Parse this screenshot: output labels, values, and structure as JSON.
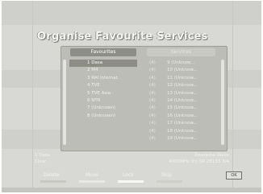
{
  "title": "Organise Favourite Services",
  "favourites": {
    "header": "Favourites",
    "items": [
      {
        "label": "1 Dasa",
        "selected": true
      },
      {
        "label": "2 M4",
        "selected": false
      },
      {
        "label": "3 RAI Internat.",
        "selected": false
      },
      {
        "label": "4 TVE",
        "selected": false
      },
      {
        "label": "5 TVE Asia",
        "selected": false
      },
      {
        "label": "6 NTR",
        "selected": false
      },
      {
        "label": "7 (Unknown)",
        "selected": false
      },
      {
        "label": "8 (Unknown)",
        "selected": false
      }
    ]
  },
  "services": {
    "header": "Services",
    "items": [
      {
        "group": "(4)",
        "name": "9 (Unknow..."
      },
      {
        "group": "(4)",
        "name": "10 (Unknow..."
      },
      {
        "group": "(4)",
        "name": "11 (Unknow..."
      },
      {
        "group": "(4)",
        "name": "12 (Unknow..."
      },
      {
        "group": "(4)",
        "name": "13 (Unknow..."
      },
      {
        "group": "(4)",
        "name": "14 (Unknow..."
      },
      {
        "group": "(4)",
        "name": "15 (Unknow..."
      },
      {
        "group": "(4)",
        "name": "16 (Unknow..."
      },
      {
        "group": "(4)",
        "name": "17 (Unknow..."
      },
      {
        "group": "(4)",
        "name": "18 (Unknow..."
      },
      {
        "group": "(4)",
        "name": "19 (Unknow..."
      }
    ]
  },
  "status": {
    "left_line1": "1 Dasa",
    "left_line2": "Clear",
    "right_line1": "Deutsche Welle",
    "right_line2": "4000MHz (H) SR 28133 3/4"
  },
  "legend": {
    "delete": "Delete",
    "move": "Move",
    "lock": "Lock",
    "skip": "Skip"
  },
  "ok_badge": "OK"
}
